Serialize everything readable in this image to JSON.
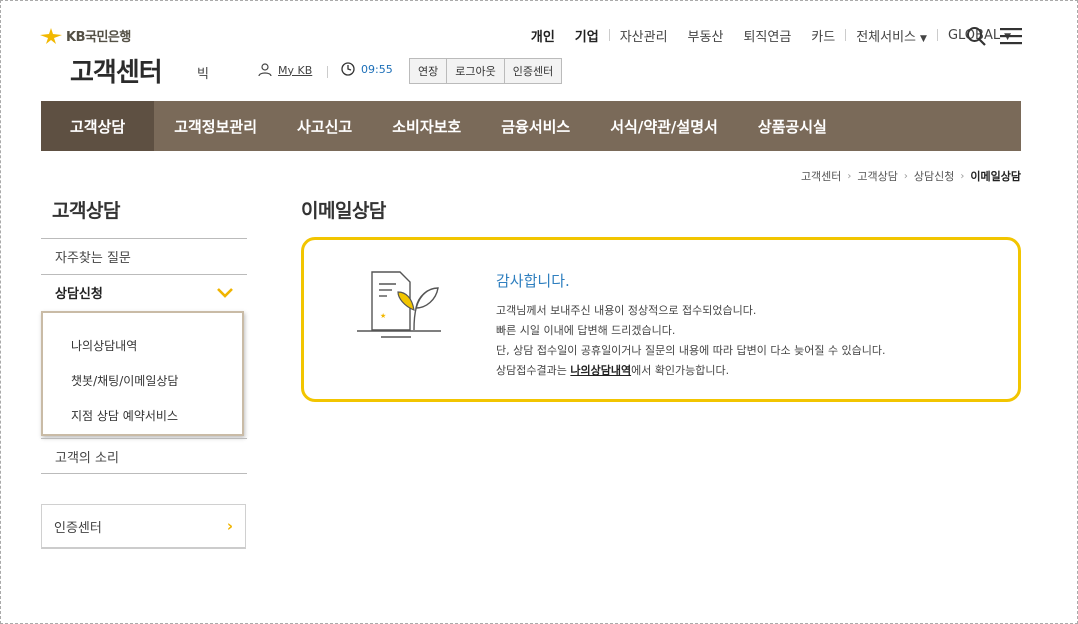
{
  "brand": {
    "logo_text": "KB국민은행",
    "site_title": "고객센터",
    "font_size_label": "빅"
  },
  "user": {
    "mykb_label": "My KB",
    "timer": "09:55"
  },
  "session_buttons": [
    "연장",
    "로그아웃",
    "인증센터"
  ],
  "topnav": {
    "personal": "개인",
    "corporate": "기업",
    "items": [
      "자산관리",
      "부동산",
      "퇴직연금",
      "카드"
    ],
    "all_services": "전체서비스",
    "global": "GLOBAL"
  },
  "gnb": [
    "고객상담",
    "고객정보관리",
    "사고신고",
    "소비자보호",
    "금융서비스",
    "서식/약관/설명서",
    "상품공시실"
  ],
  "breadcrumb": [
    "고객센터",
    "고객상담",
    "상담신청",
    "이메일상담"
  ],
  "sidebar": {
    "title": "고객상담",
    "faq": "자주찾는 질문",
    "consult": "상담신청",
    "sub_items": [
      "나의상담내역",
      "챗봇/채팅/이메일상담",
      "지점 상담 예약서비스"
    ],
    "voice": "고객의 소리",
    "cert_center": "인증센터"
  },
  "main": {
    "title": "이메일상담",
    "thanks": "감사합니다.",
    "line1": "고객님께서 보내주신 내용이 정상적으로 접수되었습니다.",
    "line2": "빠른 시일 이내에 답변해 드리겠습니다.",
    "line3": "단, 상담 접수일이 공휴일이거나 질문의 내용에 따라 답변이 다소 늦어질 수 있습니다.",
    "line4_prefix": "상담접수결과는 ",
    "line4_link": "나의상담내역",
    "line4_suffix": "에서 확인가능합니다."
  },
  "colors": {
    "gnb_bg": "#7a6a59",
    "gnb_active": "#5e5042",
    "accent": "#f2c500",
    "thanks_text": "#2f7fbf"
  },
  "icons": [
    "kb-star-icon",
    "person-icon",
    "clock-icon",
    "search-icon",
    "hamburger-menu-icon",
    "chevron-down-icon",
    "chevron-right-icon"
  ]
}
